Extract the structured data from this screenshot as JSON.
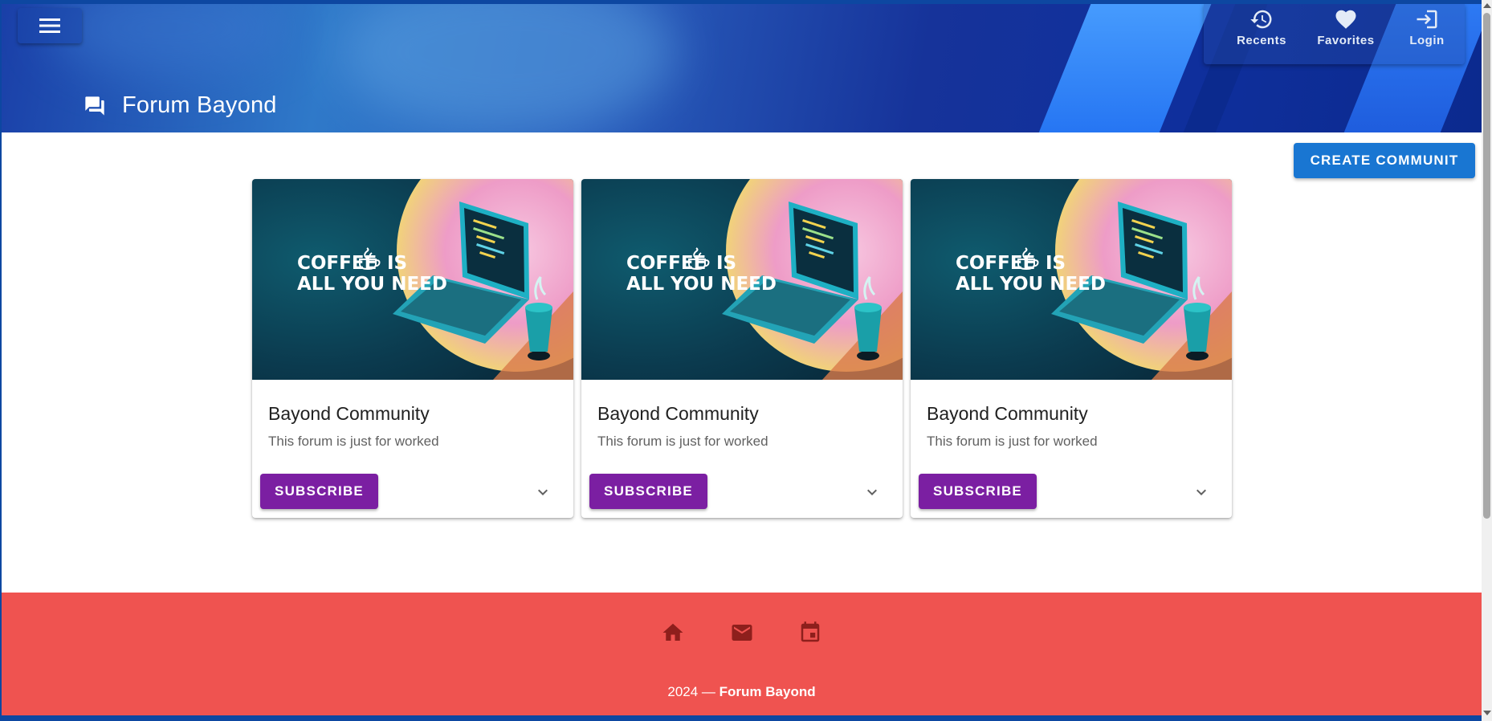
{
  "header": {
    "menu_icon": "hamburger-menu-icon",
    "title": "Forum Bayond",
    "title_icon": "forum-icon",
    "nav": [
      {
        "label": "Recents",
        "icon": "history-icon"
      },
      {
        "label": "Favorites",
        "icon": "heart-icon"
      },
      {
        "label": "Login",
        "icon": "login-icon"
      }
    ]
  },
  "main": {
    "create_button_label": "CREATE COMMUNIT",
    "cards": [
      {
        "media_line1": "COFFEE",
        "media_line1b": "IS",
        "media_line2": "ALL YOU NEED",
        "title": "Bayond Community",
        "subtitle": "This forum is just for worked",
        "subscribe_label": "SUBSCRIBE"
      },
      {
        "media_line1": "COFFEE",
        "media_line1b": "IS",
        "media_line2": "ALL YOU NEED",
        "title": "Bayond Community",
        "subtitle": "This forum is just for worked",
        "subscribe_label": "SUBSCRIBE"
      },
      {
        "media_line1": "COFFEE",
        "media_line1b": "IS",
        "media_line2": "ALL YOU NEED",
        "title": "Bayond Community",
        "subtitle": "This forum is just for worked",
        "subscribe_label": "SUBSCRIBE"
      }
    ]
  },
  "footer": {
    "icons": [
      "home-icon",
      "email-icon",
      "calendar-icon"
    ],
    "year_text": "2024 —",
    "brand": "Forum Bayond"
  },
  "colors": {
    "header_blue": "#0d47a1",
    "create_button": "#1976d2",
    "subscribe_button": "#7b1fa2",
    "footer_red": "#ef5350"
  }
}
